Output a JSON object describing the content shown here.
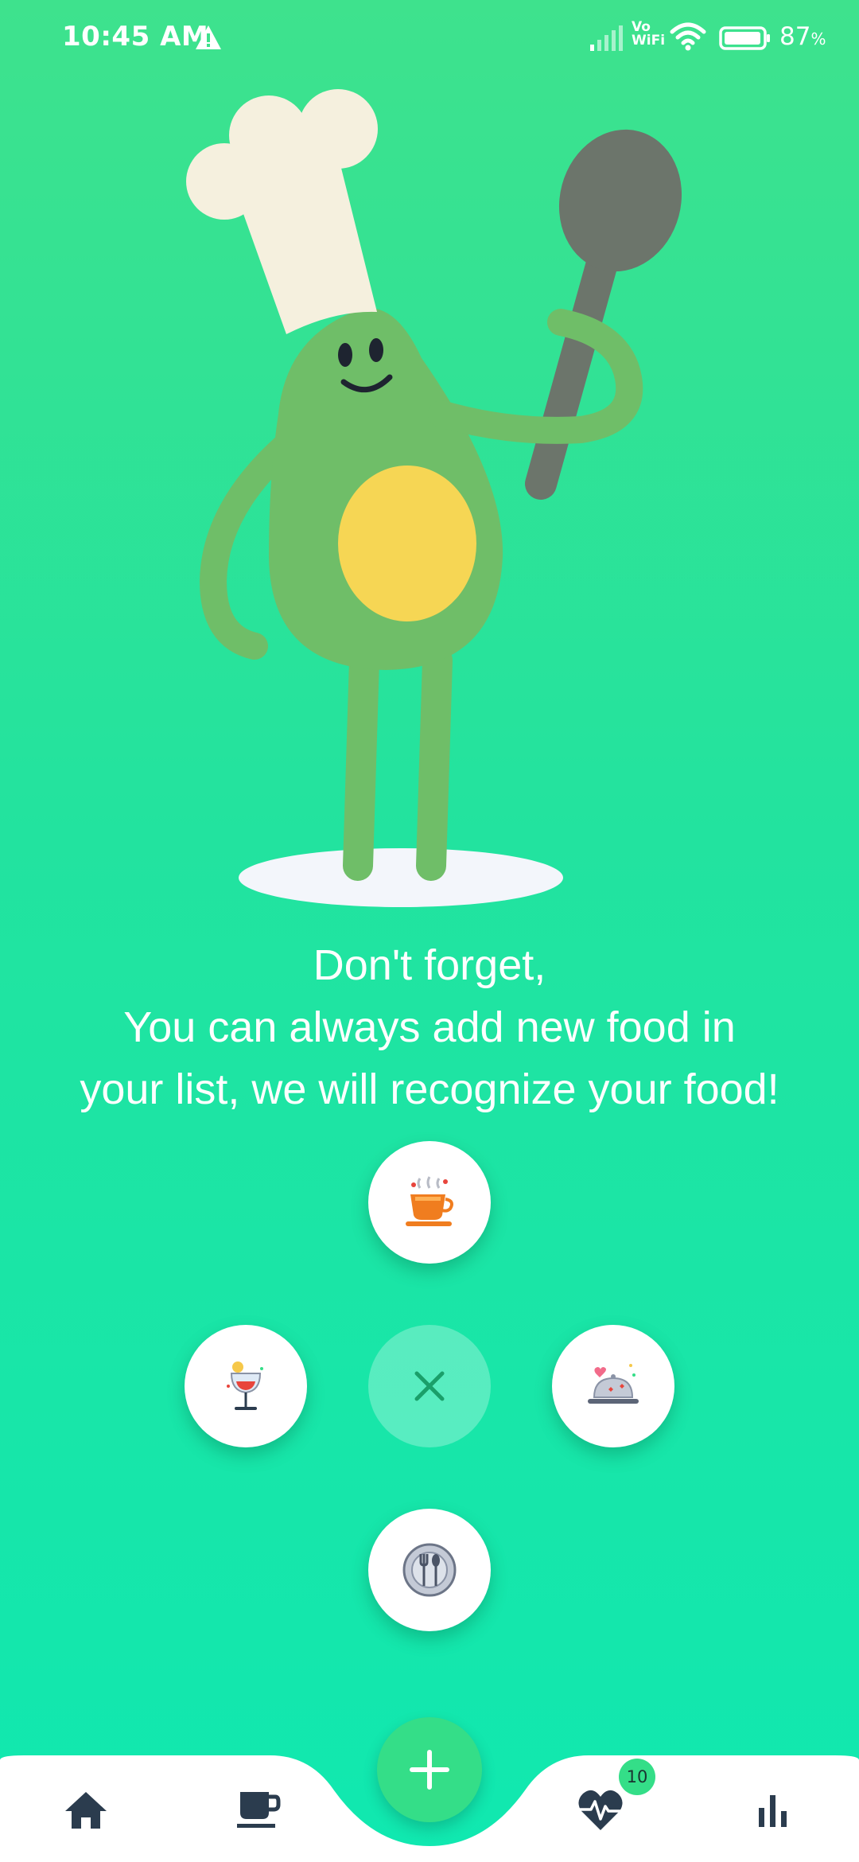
{
  "status_bar": {
    "time": "10:45 AM",
    "network": "Vo\nWiFi",
    "battery_percent": "87",
    "battery_unit": "%"
  },
  "message": {
    "line1": "Don't forget,",
    "line2": "You can always add new food in",
    "line3": "your list, we will recognize your food!"
  },
  "speed_dial": {
    "items": [
      {
        "icon": "hot-drink-icon",
        "position": "top"
      },
      {
        "icon": "cocktail-icon",
        "position": "left"
      },
      {
        "icon": "close-icon",
        "position": "center"
      },
      {
        "icon": "dessert-cloche-icon",
        "position": "right"
      },
      {
        "icon": "plate-cutlery-icon",
        "position": "bottom"
      }
    ]
  },
  "bottom_nav": {
    "items": [
      "home-icon",
      "coffee-cup-icon",
      "add-icon",
      "heart-pulse-icon",
      "bar-chart-icon"
    ],
    "badge_count": "10"
  },
  "colors": {
    "accent": "#34de88",
    "nav_icon": "#2b3c4e",
    "background_top": "#3ee28d",
    "background_bottom": "#10e8b0"
  }
}
